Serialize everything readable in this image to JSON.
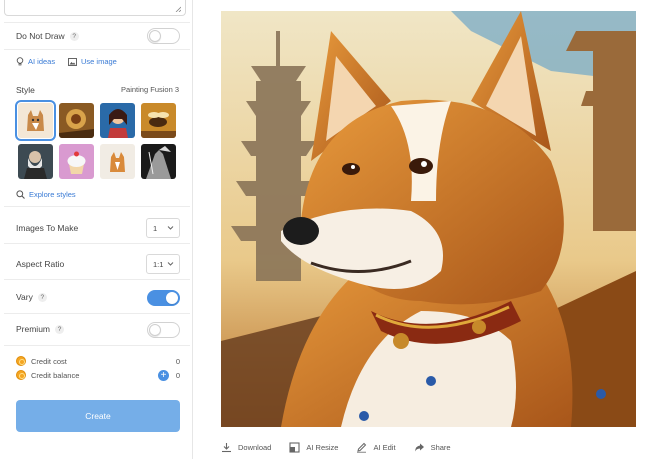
{
  "toggles": {
    "do_not_draw_label": "Do Not Draw",
    "do_not_draw_on": false,
    "vary_label": "Vary",
    "vary_on": true,
    "premium_label": "Premium",
    "premium_on": false
  },
  "help_glyph": "?",
  "links": {
    "ai_ideas": "AI ideas",
    "use_image": "Use image",
    "explore_styles": "Explore styles"
  },
  "style": {
    "title": "Style",
    "selected_name": "Painting Fusion 3",
    "thumbnails": [
      {
        "name": "style-thumb-1",
        "selected": true
      },
      {
        "name": "style-thumb-2",
        "selected": false
      },
      {
        "name": "style-thumb-3",
        "selected": false
      },
      {
        "name": "style-thumb-4",
        "selected": false
      },
      {
        "name": "style-thumb-5",
        "selected": false
      },
      {
        "name": "style-thumb-6",
        "selected": false
      },
      {
        "name": "style-thumb-7",
        "selected": false
      },
      {
        "name": "style-thumb-8",
        "selected": false
      }
    ]
  },
  "settings": {
    "images_label": "Images To Make",
    "images_value": "1",
    "aspect_label": "Aspect Ratio",
    "aspect_value": "1:1"
  },
  "credits": {
    "cost_label": "Credit cost",
    "cost_value": "0",
    "balance_label": "Credit balance",
    "balance_value": "0",
    "add_glyph": "+"
  },
  "create_label": "Create",
  "actions": {
    "download": "Download",
    "resize": "AI Resize",
    "edit": "AI Edit",
    "share": "Share"
  },
  "colors": {
    "accent": "#4a90e2",
    "create_button": "#75aee8",
    "coin": "#f5a623"
  }
}
